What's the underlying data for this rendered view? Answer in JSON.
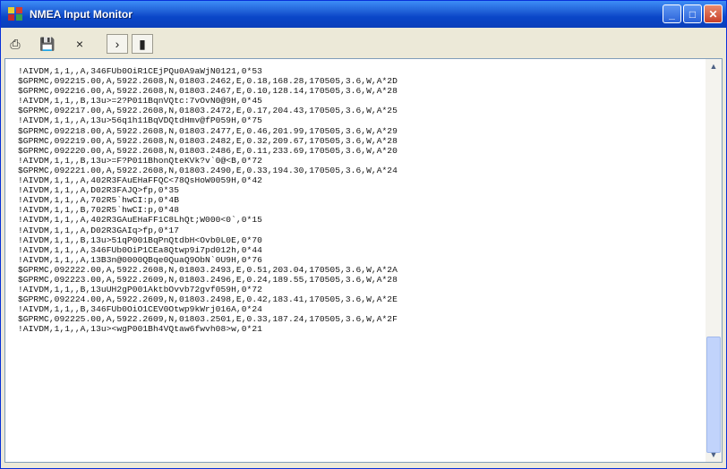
{
  "window": {
    "title": "NMEA Input Monitor"
  },
  "titlebar_buttons": {
    "minimize": "_",
    "maximize": "□",
    "close": "✕"
  },
  "toolbar": {
    "print_icon": "⎙",
    "save_icon": "💾",
    "clear_label": "×",
    "play_label": "›",
    "pause_label": "▮"
  },
  "log_lines": [
    "!AIVDM,1,1,,A,346FUb0OiR1CEjPQu0A9aWjN0121,0*53",
    "$GPRMC,092215.00,A,5922.2608,N,01803.2462,E,0.18,168.28,170505,3.6,W,A*2D",
    "$GPRMC,092216.00,A,5922.2608,N,01803.2467,E,0.10,128.14,170505,3.6,W,A*28",
    "!AIVDM,1,1,,B,13u>=2?P011BqnVQtc:7vOvN0@9H,0*45",
    "$GPRMC,092217.00,A,5922.2608,N,01803.2472,E,0.17,204.43,170505,3.6,W,A*25",
    "!AIVDM,1,1,,A,13u>56q1h11BqVDQtdHmv@fP059H,0*75",
    "$GPRMC,092218.00,A,5922.2608,N,01803.2477,E,0.46,201.99,170505,3.6,W,A*29",
    "$GPRMC,092219.00,A,5922.2608,N,01803.2482,E,0.32,209.67,170505,3.6,W,A*28",
    "$GPRMC,092220.00,A,5922.2608,N,01803.2486,E,0.11,233.69,170505,3.6,W,A*20",
    "!AIVDM,1,1,,B,13u>=F?P011BhonQteKVk?v`0@<B,0*72",
    "$GPRMC,092221.00,A,5922.2608,N,01803.2490,E,0.33,194.30,170505,3.6,W,A*24",
    "!AIVDM,1,1,,A,402R3FAuEHaFFQC<78QsHoW0059H,0*42",
    "!AIVDM,1,1,,A,D02R3FAJQ>fp,0*35",
    "!AIVDM,1,1,,A,702R5`hwCI:p,0*4B",
    "!AIVDM,1,1,,B,702R5`hwCI:p,0*48",
    "!AIVDM,1,1,,A,402R3GAuEHaFF1C8LhQt;W000<0`,0*15",
    "!AIVDM,1,1,,A,D02R3GAIq>fp,0*17",
    "!AIVDM,1,1,,B,13u>51qP001BqPnQtdbH<Ovb0L0E,0*70",
    "!AIVDM,1,1,,A,346FUb0OiP1CEa8Qtwp9i7pd012h,0*44",
    "!AIVDM,1,1,,A,13B3n@0000QBqe0QuaQ9ObN`0U9H,0*76",
    "$GPRMC,092222.00,A,5922.2608,N,01803.2493,E,0.51,203.04,170505,3.6,W,A*2A",
    "$GPRMC,092223.00,A,5922.2609,N,01803.2496,E,0.24,189.55,170505,3.6,W,A*28",
    "!AIVDM,1,1,,B,13uUH2gP001AktbOvvb72gvf059H,0*72",
    "$GPRMC,092224.00,A,5922.2609,N,01803.2498,E,0.42,183.41,170505,3.6,W,A*2E",
    "!AIVDM,1,1,,B,346FUb0OiO1CEV0Otwp9kWrj016A,0*24",
    "$GPRMC,092225.00,A,5922.2609,N,01803.2501,E,0.33,187.24,170505,3.6,W,A*2F",
    "!AIVDM,1,1,,A,13u><wgP001Bh4VQtaw6fwvh08>w,0*21"
  ]
}
